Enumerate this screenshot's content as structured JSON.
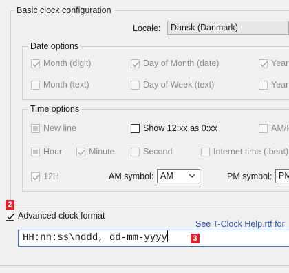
{
  "basic": {
    "title": "Basic clock configuration",
    "locale_label": "Locale:",
    "locale_value": "Dansk (Danmark)"
  },
  "date_options": {
    "title": "Date options",
    "month_digit": "Month (digit)",
    "day_of_month": "Day of Month (date)",
    "year": "Year",
    "month_text": "Month (text)",
    "day_of_week": "Day of Week (text)",
    "year2": "Year"
  },
  "time_options": {
    "title": "Time options",
    "new_line": "New line",
    "show_12xx": "Show 12:xx as 0:xx",
    "am_pm": "AM/PM",
    "hour": "Hour",
    "minute": "Minute",
    "second": "Second",
    "internet_time": "Internet time (.beat)",
    "h12": "12H",
    "am_symbol_label": "AM symbol:",
    "am_symbol_value": "AM",
    "pm_symbol_label": "PM symbol:",
    "pm_symbol_value": "PM"
  },
  "advanced": {
    "label": "Advanced clock format",
    "help_link": "See T-Clock Help.rtf for",
    "format_value": "HH:nn:ss\\nddd, dd-mm-yyyy"
  },
  "markers": {
    "advanced": "2",
    "format": "3"
  },
  "colors": {
    "marker": "#d6262b",
    "link": "#2a5ab3",
    "focus_border": "#3a6fd8"
  }
}
